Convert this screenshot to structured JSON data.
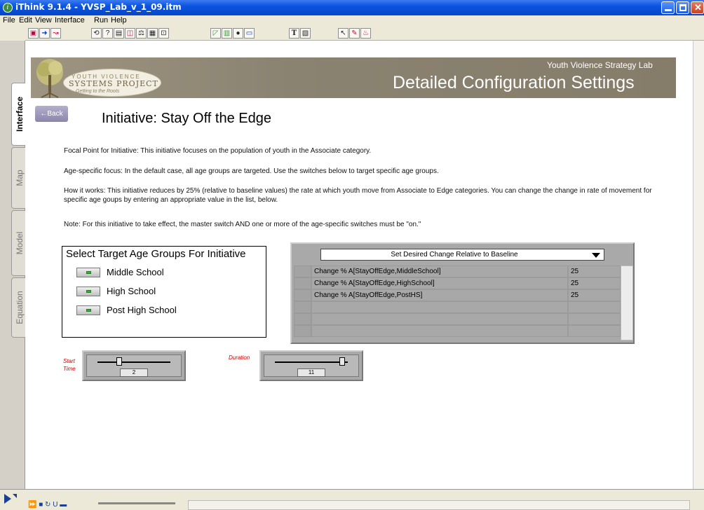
{
  "window": {
    "title": "iThink 9.1.4 - YVSP_Lab_v_1_09.itm",
    "app_icon": "i"
  },
  "menu": [
    "File",
    "Edit",
    "View",
    "Interface",
    "Run",
    "Help"
  ],
  "toolbar": {
    "text_tool": "T"
  },
  "side_tabs": [
    "Interface",
    "Map",
    "Model",
    "Equation"
  ],
  "banner": {
    "logo_line1": "YOUTH VIOLENCE",
    "logo_line2": "SYSTEMS PROJECT",
    "logo_line3": "Getting to the Roots",
    "subtitle": "Youth Violence Strategy Lab",
    "title": "Detailed Configuration Settings"
  },
  "back_label": "←Back",
  "heading": "Initiative:  Stay Off the Edge",
  "paragraphs": [
    "Focal Point for Initiative:  This initiative focuses on the population of youth in the Associate category.",
    "Age-specific focus:  In the default case, all age groups are targeted.  Use the switches below to target specific age groups.",
    "How it works:  This initiative reduces by 25% (relative to baseline values) the rate at which youth move from Associate to Edge categories.  You can change the change in rate of movement for specific age goups by entering an appropriate value in the list, below.",
    "Note:  For this initiative to take effect, the master switch AND one or more of the age-specific switches must be \"on.\""
  ],
  "switch_box": {
    "title": "Select Target Age Groups For Initiative",
    "items": [
      "Middle School",
      "High School",
      "Post High School"
    ]
  },
  "table": {
    "dropdown": "Set Desired Change Relative to Baseline",
    "rows": [
      {
        "name": "Change % A[StayOffEdge,MiddleSchool]",
        "value": "25"
      },
      {
        "name": "Change % A[StayOffEdge,HighSchool]",
        "value": "25"
      },
      {
        "name": "Change % A[StayOffEdge,PostHS]",
        "value": "25"
      },
      {
        "name": "",
        "value": ""
      },
      {
        "name": "",
        "value": ""
      },
      {
        "name": "",
        "value": ""
      }
    ]
  },
  "sliders": [
    {
      "label": "Start Time",
      "value": "2",
      "level": 0.3
    },
    {
      "label": "Duration",
      "value": "11",
      "level": 0.92
    }
  ],
  "colors": {
    "titlebar": "#0a54e0",
    "banner": "#8b8371",
    "slider_label": "#cc0000",
    "switch_on": "#2fb52f"
  }
}
